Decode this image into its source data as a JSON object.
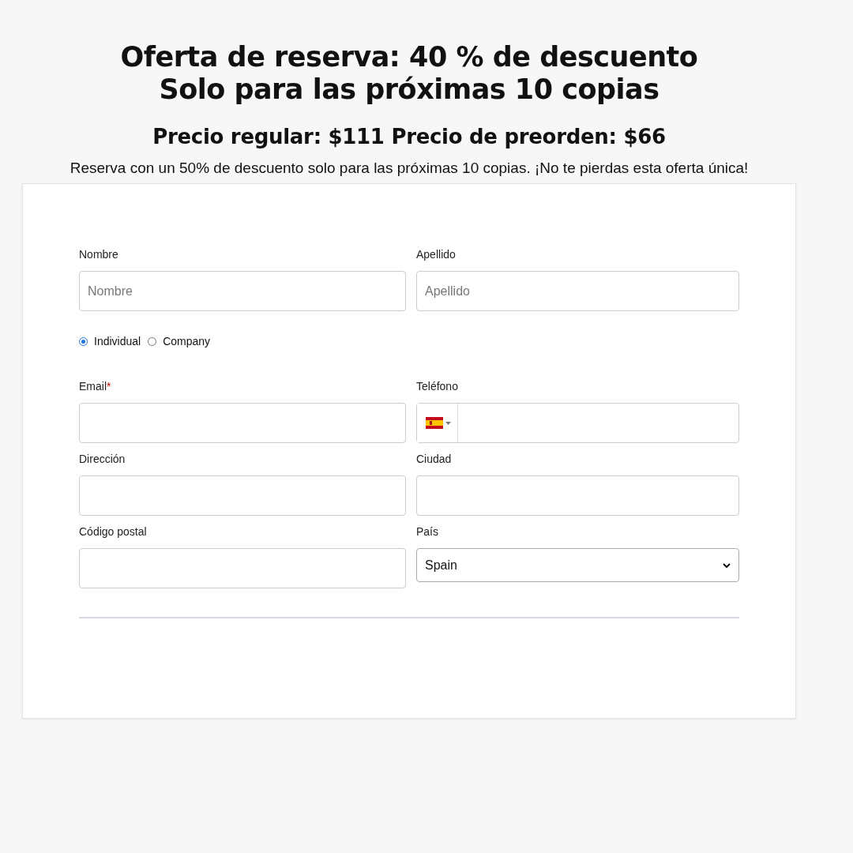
{
  "offer": {
    "headline": [
      "Oferta de reserva: 40 % de descuento",
      "Solo para las próximas 10 copias"
    ],
    "price_line": "Precio regular: $111 Precio de preorden: $66",
    "description": "Reserva con un 50% de descuento solo para las próximas 10 copias. ¡No te pierdas esta oferta única!"
  },
  "form": {
    "name_row": [
      {
        "kind": "text",
        "label": "Nombre",
        "placeholder": "Nombre"
      },
      {
        "kind": "text",
        "label": "Apellido",
        "placeholder": "Apellido"
      }
    ],
    "customer_type": [
      {
        "label": "Individual",
        "selected": true
      },
      {
        "label": "Company",
        "selected": false
      }
    ],
    "rows": [
      [
        {
          "kind": "text",
          "label": "Email",
          "required_mark": "*"
        },
        {
          "kind": "phone",
          "label": "Teléfono"
        }
      ],
      [
        {
          "kind": "text",
          "label": "Dirección"
        },
        {
          "kind": "text",
          "label": "Ciudad"
        }
      ],
      [
        {
          "kind": "text",
          "label": "Código postal"
        },
        {
          "kind": "select",
          "label": "País",
          "value": "Spain"
        }
      ]
    ]
  }
}
